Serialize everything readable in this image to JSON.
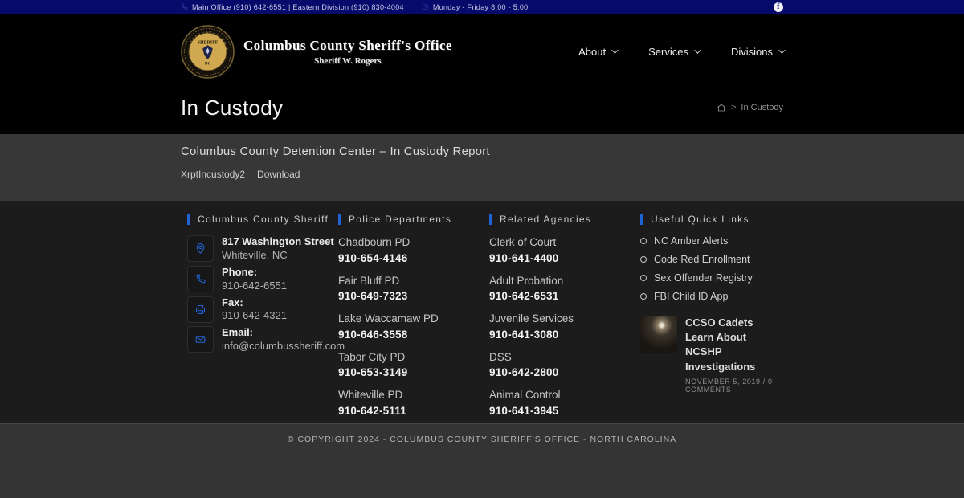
{
  "colors": {
    "topbar_bg": "#060a6a",
    "accent_blue": "#2065d6",
    "header_bg": "#000000",
    "content_bg": "#373737",
    "footer_bg": "#1c1c1c"
  },
  "topbar": {
    "contact": "Main Office (910) 642-6551 | Eastern Division (910) 830-4004",
    "hours": "Monday - Friday 8:00 - 5:00"
  },
  "header": {
    "brand_title": "Columbus County Sheriff's Office",
    "brand_subtitle": "Sheriff W. Rogers",
    "nav": [
      {
        "label": "About"
      },
      {
        "label": "Services"
      },
      {
        "label": "Divisions"
      }
    ]
  },
  "page": {
    "title": "In Custody",
    "breadcrumb_separator": ">",
    "breadcrumb_current": "In Custody"
  },
  "content": {
    "heading": "Columbus County Detention Center – In Custody Report",
    "links": [
      {
        "label": "XrptIncustody2"
      },
      {
        "label": "Download"
      }
    ]
  },
  "footer": {
    "sheriff": {
      "heading": "Columbus County Sheriff",
      "contacts": [
        {
          "icon": "location-icon",
          "line1": "817 Washington Street",
          "line2": "Whiteville, NC"
        },
        {
          "icon": "phone-icon",
          "line1": "Phone:",
          "line2": "910-642-6551"
        },
        {
          "icon": "fax-icon",
          "line1": "Fax:",
          "line2": "910-642-4321"
        },
        {
          "icon": "email-icon",
          "line1": "Email:",
          "line2": "info@columbussheriff.com"
        }
      ]
    },
    "police": {
      "heading": "Police Departments",
      "items": [
        {
          "name": "Chadbourn PD",
          "phone": "910-654-4146"
        },
        {
          "name": "Fair Bluff PD",
          "phone": "910-649-7323"
        },
        {
          "name": "Lake Waccamaw PD",
          "phone": "910-646-3558"
        },
        {
          "name": "Tabor City PD",
          "phone": "910-653-3149"
        },
        {
          "name": "Whiteville PD",
          "phone": "910-642-5111"
        }
      ]
    },
    "agencies": {
      "heading": "Related Agencies",
      "items": [
        {
          "name": "Clerk of Court",
          "phone": "910-641-4400"
        },
        {
          "name": "Adult Probation",
          "phone": "910-642-6531"
        },
        {
          "name": "Juvenile Services",
          "phone": "910-641-3080"
        },
        {
          "name": "DSS",
          "phone": "910-642-2800"
        },
        {
          "name": "Animal Control",
          "phone": "910-641-3945"
        }
      ]
    },
    "quicklinks": {
      "heading": "Useful Quick Links",
      "items": [
        {
          "label": "NC Amber Alerts"
        },
        {
          "label": "Code Red Enrollment"
        },
        {
          "label": "Sex Offender Registry"
        },
        {
          "label": "FBI Child ID App"
        }
      ],
      "news": {
        "title": "CCSO Cadets Learn About NCSHP Investigations",
        "meta": "November 5, 2019 /  0 Comments"
      }
    },
    "copyright": "© Copyright 2024 - Columbus County Sheriff's Office - North Carolina"
  }
}
